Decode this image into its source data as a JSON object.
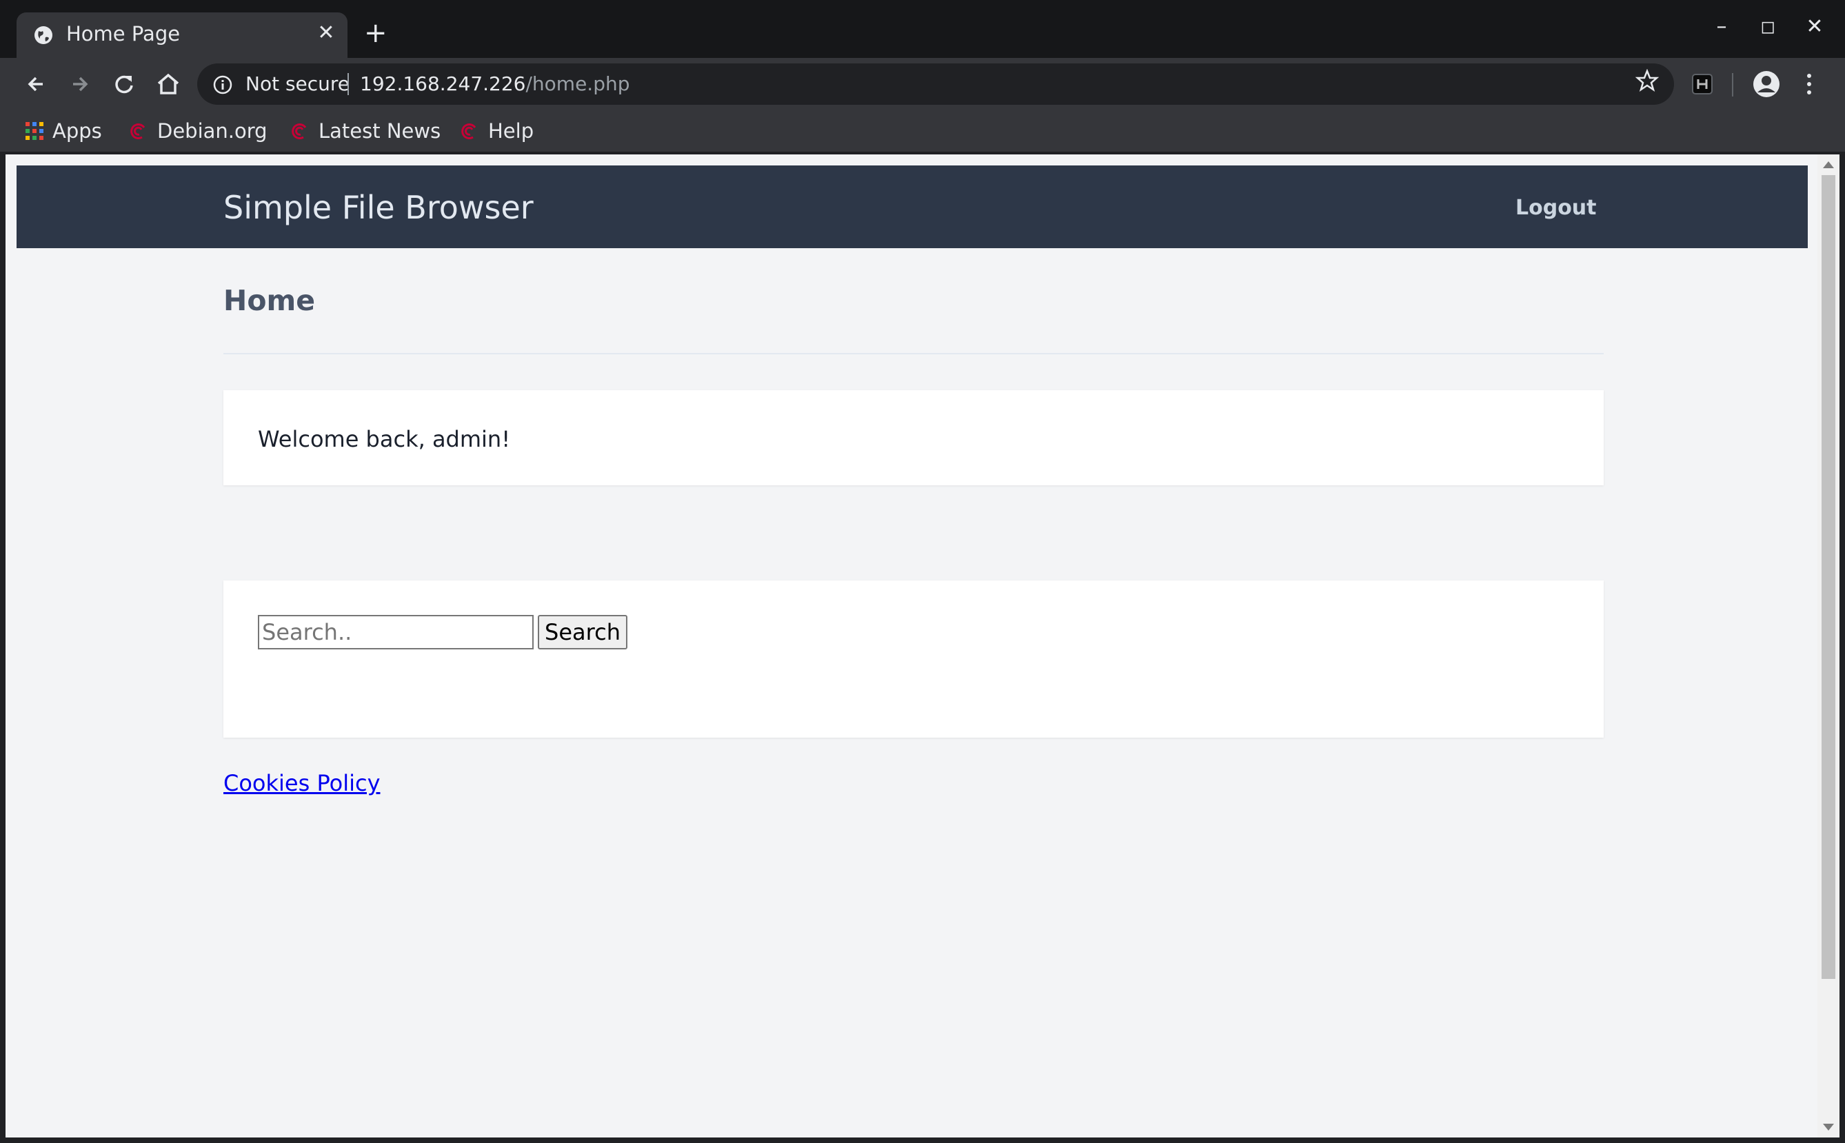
{
  "browser": {
    "tab_title": "Home Page",
    "security_label": "Not secure",
    "url_host": "192.168.247.226",
    "url_path": "/home.php",
    "bookmarks": [
      {
        "label": "Apps",
        "icon": "apps-grid-icon"
      },
      {
        "label": "Debian.org",
        "icon": "debian-swirl-icon"
      },
      {
        "label": "Latest News",
        "icon": "debian-swirl-icon"
      },
      {
        "label": "Help",
        "icon": "debian-swirl-icon"
      }
    ],
    "colors": {
      "chrome_dark": "#202124",
      "toolbar": "#35363a",
      "text": "#e8eaed"
    }
  },
  "site": {
    "title": "Simple File Browser",
    "logout_label": "Logout",
    "heading": "Home",
    "welcome": "Welcome back, admin!",
    "search": {
      "placeholder": "Search..",
      "button_label": "Search"
    },
    "cookies_link": "Cookies Policy",
    "colors": {
      "header": "#2d3748",
      "background": "#f3f4f6",
      "card": "#ffffff",
      "link": "#0000ee"
    }
  }
}
